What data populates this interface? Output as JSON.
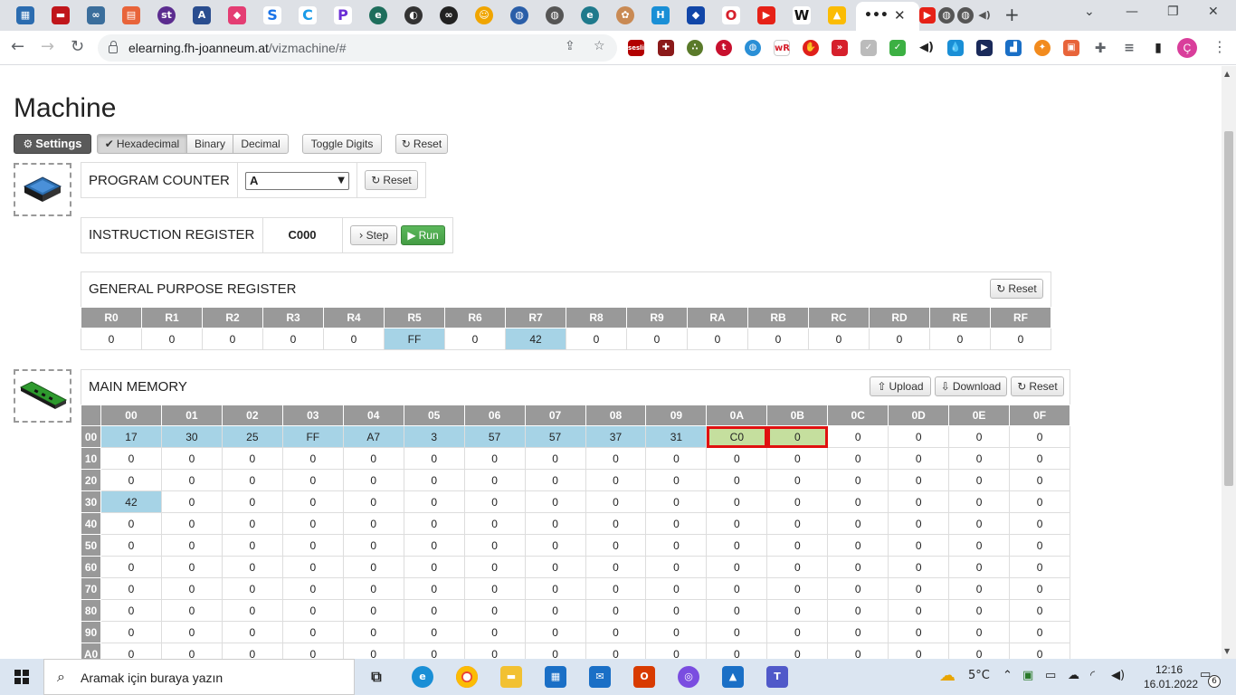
{
  "browser": {
    "url_domain": "elearning.fh-joanneum.at",
    "url_path": "/vizmachine/#"
  },
  "page": {
    "title": "Machine",
    "settings_label": "Settings",
    "format_buttons": [
      "Hexadecimal",
      "Binary",
      "Decimal"
    ],
    "active_format": "Hexadecimal",
    "toggle_digits_label": "Toggle Digits",
    "reset_label": "Reset"
  },
  "program_counter": {
    "label": "PROGRAM COUNTER",
    "value": "A",
    "reset_label": "Reset"
  },
  "instruction_register": {
    "label": "INSTRUCTION REGISTER",
    "value": "C000",
    "step_label": "Step",
    "run_label": "Run"
  },
  "gpr": {
    "label": "GENERAL PURPOSE REGISTER",
    "reset_label": "Reset",
    "registers": [
      "R0",
      "R1",
      "R2",
      "R3",
      "R4",
      "R5",
      "R6",
      "R7",
      "R8",
      "R9",
      "RA",
      "RB",
      "RC",
      "RD",
      "RE",
      "RF"
    ],
    "values": [
      "0",
      "0",
      "0",
      "0",
      "0",
      "FF",
      "0",
      "42",
      "0",
      "0",
      "0",
      "0",
      "0",
      "0",
      "0",
      "0"
    ],
    "highlighted": [
      5,
      7
    ]
  },
  "memory": {
    "label": "MAIN MEMORY",
    "upload_label": "Upload",
    "download_label": "Download",
    "reset_label": "Reset",
    "columns": [
      "00",
      "01",
      "02",
      "03",
      "04",
      "05",
      "06",
      "07",
      "08",
      "09",
      "0A",
      "0B",
      "0C",
      "0D",
      "0E",
      "0F"
    ],
    "rows": [
      {
        "addr": "00",
        "cells": [
          "17",
          "30",
          "25",
          "FF",
          "A7",
          "3",
          "57",
          "57",
          "37",
          "31",
          "C0",
          "0",
          "0",
          "0",
          "0",
          "0"
        ],
        "highlight": [
          0,
          1,
          2,
          3,
          4,
          5,
          6,
          7,
          8,
          9
        ],
        "current": [
          10,
          11
        ]
      },
      {
        "addr": "10",
        "cells": [
          "0",
          "0",
          "0",
          "0",
          "0",
          "0",
          "0",
          "0",
          "0",
          "0",
          "0",
          "0",
          "0",
          "0",
          "0",
          "0"
        ]
      },
      {
        "addr": "20",
        "cells": [
          "0",
          "0",
          "0",
          "0",
          "0",
          "0",
          "0",
          "0",
          "0",
          "0",
          "0",
          "0",
          "0",
          "0",
          "0",
          "0"
        ]
      },
      {
        "addr": "30",
        "cells": [
          "42",
          "0",
          "0",
          "0",
          "0",
          "0",
          "0",
          "0",
          "0",
          "0",
          "0",
          "0",
          "0",
          "0",
          "0",
          "0"
        ],
        "highlight": [
          0
        ]
      },
      {
        "addr": "40",
        "cells": [
          "0",
          "0",
          "0",
          "0",
          "0",
          "0",
          "0",
          "0",
          "0",
          "0",
          "0",
          "0",
          "0",
          "0",
          "0",
          "0"
        ]
      },
      {
        "addr": "50",
        "cells": [
          "0",
          "0",
          "0",
          "0",
          "0",
          "0",
          "0",
          "0",
          "0",
          "0",
          "0",
          "0",
          "0",
          "0",
          "0",
          "0"
        ]
      },
      {
        "addr": "60",
        "cells": [
          "0",
          "0",
          "0",
          "0",
          "0",
          "0",
          "0",
          "0",
          "0",
          "0",
          "0",
          "0",
          "0",
          "0",
          "0",
          "0"
        ]
      },
      {
        "addr": "70",
        "cells": [
          "0",
          "0",
          "0",
          "0",
          "0",
          "0",
          "0",
          "0",
          "0",
          "0",
          "0",
          "0",
          "0",
          "0",
          "0",
          "0"
        ]
      },
      {
        "addr": "80",
        "cells": [
          "0",
          "0",
          "0",
          "0",
          "0",
          "0",
          "0",
          "0",
          "0",
          "0",
          "0",
          "0",
          "0",
          "0",
          "0",
          "0"
        ]
      },
      {
        "addr": "90",
        "cells": [
          "0",
          "0",
          "0",
          "0",
          "0",
          "0",
          "0",
          "0",
          "0",
          "0",
          "0",
          "0",
          "0",
          "0",
          "0",
          "0"
        ]
      },
      {
        "addr": "A0",
        "cells": [
          "0",
          "0",
          "0",
          "0",
          "0",
          "0",
          "0",
          "0",
          "0",
          "0",
          "0",
          "0",
          "0",
          "0",
          "0",
          "0"
        ]
      }
    ]
  },
  "taskbar": {
    "search_placeholder": "Aramak için buraya yazın",
    "weather": "5°C",
    "time": "12:16",
    "date": "16.01.2022",
    "notifications": "6"
  },
  "colors": {
    "highlight_cell": "#a6d3e6",
    "current_cell": "#c5df9e",
    "current_border": "#e01010",
    "header_bg": "#999999",
    "run_button": "#5cb85c"
  }
}
